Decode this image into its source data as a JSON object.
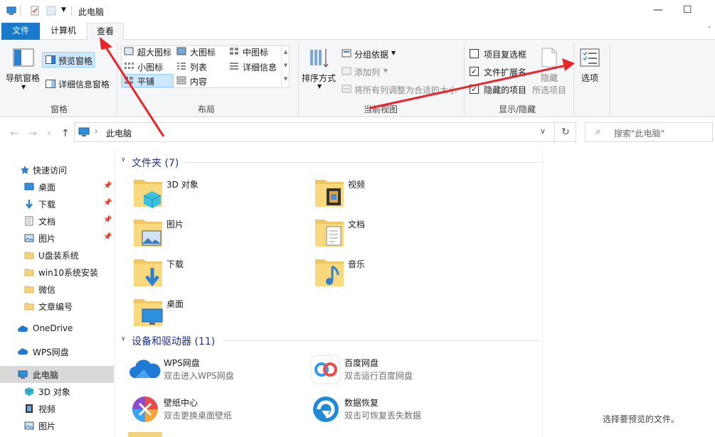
{
  "window": {
    "title": "此电脑",
    "minimize": "—",
    "maximize": "☐"
  },
  "tabs": [
    {
      "label": "文件"
    },
    {
      "label": "计算机"
    },
    {
      "label": "查看"
    }
  ],
  "ribbon": {
    "panes": {
      "nav_pane": "导航窗格",
      "preview_pane": "预览窗格",
      "details_pane": "详细信息窗格",
      "group": "窗格"
    },
    "layout": {
      "items": [
        "超大图标",
        "大图标",
        "中图标",
        "小图标",
        "列表",
        "详细信息",
        "平铺",
        "内容"
      ],
      "group": "布局"
    },
    "current_view": {
      "sort_by": "排序方式",
      "group_by": "分组依据",
      "add_columns": "添加列",
      "fit_columns": "将所有列调整为合适的大小",
      "group": "当前视图"
    },
    "show_hide": {
      "item_checkboxes": "项目复选框",
      "file_extensions": "文件扩展名",
      "hidden_items": "隐藏的项目",
      "hide": "隐藏",
      "hide_selected": "所选项目",
      "group": "显示/隐藏"
    },
    "options": "选项"
  },
  "address": {
    "path": "此电脑",
    "search_placeholder": "搜索\"此电脑\""
  },
  "nav": [
    {
      "label": "快速访问",
      "icon": "star-icon"
    },
    {
      "label": "桌面",
      "icon": "desktop-icon",
      "pinned": true
    },
    {
      "label": "下载",
      "icon": "download-icon",
      "pinned": true
    },
    {
      "label": "文档",
      "icon": "document-icon",
      "pinned": true
    },
    {
      "label": "图片",
      "icon": "pictures-icon",
      "pinned": true
    },
    {
      "label": "U盘装系统",
      "icon": "folder-icon"
    },
    {
      "label": "win10系统安装",
      "icon": "folder-icon"
    },
    {
      "label": "微信",
      "icon": "folder-icon"
    },
    {
      "label": "文章编号",
      "icon": "folder-icon"
    },
    {
      "label": "OneDrive",
      "icon": "cloud-icon"
    },
    {
      "label": "WPS网盘",
      "icon": "cloud-icon"
    },
    {
      "label": "此电脑",
      "icon": "computer-icon"
    },
    {
      "label": "3D 对象",
      "icon": "cube-icon"
    },
    {
      "label": "视频",
      "icon": "video-icon"
    },
    {
      "label": "图片",
      "icon": "pictures-icon"
    }
  ],
  "content": {
    "folders_header": "文件夹 (7)",
    "folders": [
      {
        "label": "3D 对象"
      },
      {
        "label": "视频"
      },
      {
        "label": "图片"
      },
      {
        "label": "文档"
      },
      {
        "label": "下载"
      },
      {
        "label": "音乐"
      },
      {
        "label": "桌面"
      }
    ],
    "devices_header": "设备和驱动器 (11)",
    "devices": [
      {
        "label": "WPS网盘",
        "sub": "双击进入WPS网盘"
      },
      {
        "label": "百度网盘",
        "sub": "双击运行百度网盘"
      },
      {
        "label": "壁纸中心",
        "sub": "双击更换桌面壁纸"
      },
      {
        "label": "数据恢复",
        "sub": "双击可恢复丢失数据"
      }
    ]
  },
  "preview": {
    "empty_text": "选择要预览的文件。"
  },
  "colors": {
    "file_tab": "#1979ca",
    "arrow": "#e8262a",
    "section_header": "#1e3287",
    "selection": "#cce8ff"
  }
}
